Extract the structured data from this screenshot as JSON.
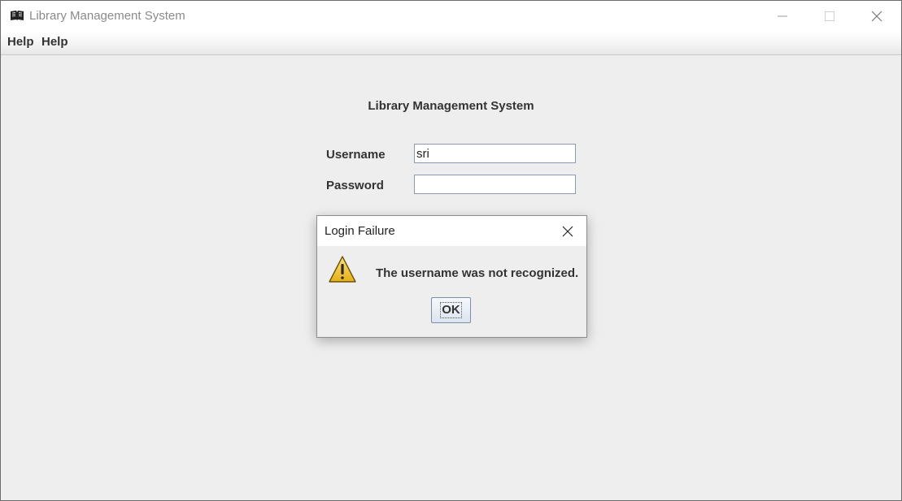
{
  "window": {
    "title": "Library Management System",
    "icon": "book-icon",
    "controls": [
      "minimize-icon",
      "maximize-icon",
      "close-icon"
    ]
  },
  "menubar": {
    "items": [
      {
        "label": "Help"
      },
      {
        "label": "Help"
      }
    ]
  },
  "form": {
    "heading": "Library Management System",
    "username": {
      "label": "Username",
      "value": "sri"
    },
    "password": {
      "label": "Password",
      "value": ""
    }
  },
  "dialog": {
    "title": "Login Failure",
    "icon": "warning-icon",
    "message": "The username was not recognized.",
    "ok_label": "OK"
  },
  "colors": {
    "background": "#eeeeee",
    "titlebar": "#ffffff",
    "warning_yellow": "#f5c518"
  }
}
